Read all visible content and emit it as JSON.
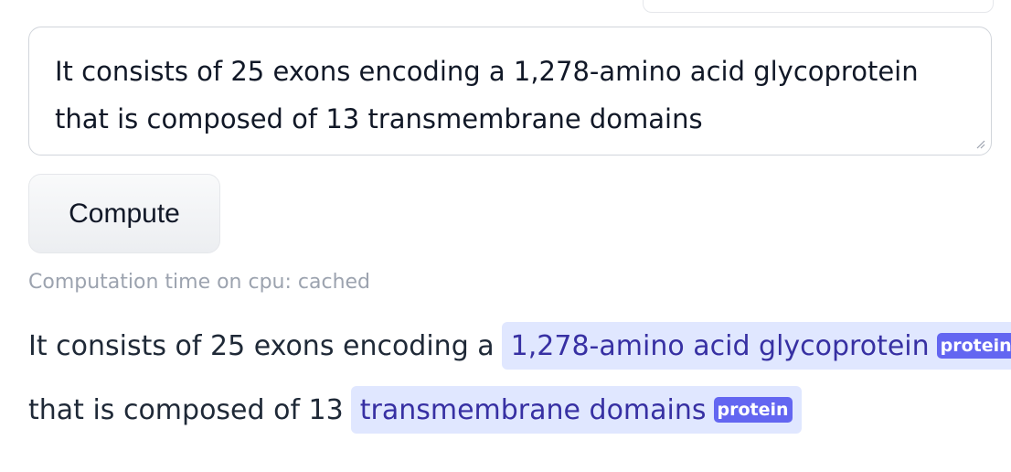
{
  "input": {
    "text": "It consists of 25 exons encoding a 1,278-amino acid glycoprotein\nthat is composed of 13 transmembrane domains"
  },
  "compute_button": {
    "label": "Compute"
  },
  "computation_time": "Computation time on cpu: cached",
  "output": {
    "line1": {
      "prefix": "It consists of 25 exons encoding a",
      "entity_text": "1,278-amino acid glycoprotein",
      "entity_label": "protein"
    },
    "line2": {
      "prefix": "that is composed of 13",
      "entity_text": "transmembrane domains",
      "entity_label": "protein"
    }
  },
  "colors": {
    "entity_bg": "#e0e7ff",
    "entity_text": "#3730a3",
    "label_bg": "#6366f1"
  }
}
